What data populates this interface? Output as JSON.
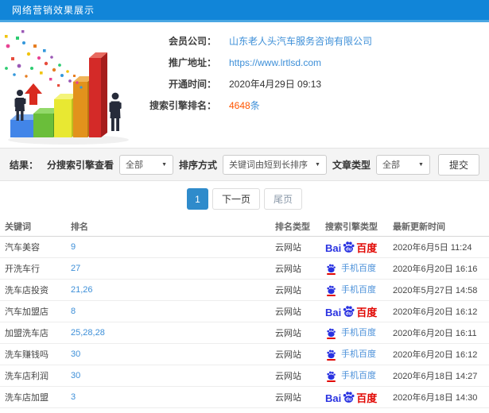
{
  "colors": {
    "header_blue": "#1185d8",
    "link_blue": "#3d8fd8",
    "count_red": "#ff5500",
    "active_page_blue": "#2f8bcb",
    "baidu_blue": "#2932e1",
    "baidu_red": "#e10602"
  },
  "header": {
    "title": "网络营销效果展示"
  },
  "info": {
    "rows": [
      {
        "label": "会员公司：",
        "value": "山东老人头汽车服务咨询有限公司"
      },
      {
        "label": "推广地址：",
        "value": "https://www.lrtlsd.com"
      },
      {
        "label": "开通时间：",
        "value": "2020年4月29日 09:13"
      },
      {
        "label": "搜索引擎排名：",
        "value": "4648",
        "suffix": "条"
      }
    ]
  },
  "filter_bar": {
    "results_label": "结果：",
    "filters": [
      {
        "label": "分搜索引擎查看",
        "value": "全部"
      },
      {
        "label": "排序方式",
        "value": "关键词由短到长排序"
      },
      {
        "label": "文章类型",
        "value": "全部"
      }
    ],
    "submit_label": "提交"
  },
  "pagination": {
    "current": "1",
    "next_label": "下一页",
    "last_label": "尾页"
  },
  "table": {
    "columns": [
      "关键词",
      "排名",
      "排名类型",
      "搜索引擎类型",
      "最新更新时间"
    ],
    "engines": {
      "baidu": {
        "prefix": "Bai",
        "paw_text": "du",
        "name": "百度"
      },
      "mobile-baidu": {
        "label": "手机百度"
      }
    },
    "rows": [
      {
        "keyword": "汽车美容",
        "rank": "9",
        "rank_type": "云网站",
        "engine": "baidu",
        "updated": "2020年6月5日 11:24"
      },
      {
        "keyword": "开洗车行",
        "rank": "27",
        "rank_type": "云网站",
        "engine": "mobile-baidu",
        "updated": "2020年6月20日 16:16"
      },
      {
        "keyword": "洗车店投资",
        "rank": "21,26",
        "rank_type": "云网站",
        "engine": "mobile-baidu",
        "updated": "2020年5月27日 14:58"
      },
      {
        "keyword": "汽车加盟店",
        "rank": "8",
        "rank_type": "云网站",
        "engine": "baidu",
        "updated": "2020年6月20日 16:12"
      },
      {
        "keyword": "加盟洗车店",
        "rank": "25,28,28",
        "rank_type": "云网站",
        "engine": "mobile-baidu",
        "updated": "2020年6月20日 16:11"
      },
      {
        "keyword": "洗车赚钱吗",
        "rank": "30",
        "rank_type": "云网站",
        "engine": "mobile-baidu",
        "updated": "2020年6月20日 16:12"
      },
      {
        "keyword": "洗车店利润",
        "rank": "30",
        "rank_type": "云网站",
        "engine": "mobile-baidu",
        "updated": "2020年6月18日 14:27"
      },
      {
        "keyword": "洗车店加盟",
        "rank": "3",
        "rank_type": "云网站",
        "engine": "baidu",
        "updated": "2020年6月18日 14:30"
      }
    ]
  }
}
